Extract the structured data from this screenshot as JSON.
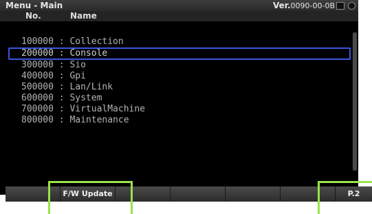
{
  "title": "Menu - Main",
  "version": {
    "label": "Ver.",
    "value": "0090-00-0B"
  },
  "columns": {
    "no": "No.",
    "name": "Name"
  },
  "menu_items": [
    {
      "text": "100000 : Collection"
    },
    {
      "text": "200000 : Console"
    },
    {
      "text": "300000 : Sio"
    },
    {
      "text": "400000 : Gpi"
    },
    {
      "text": "500000 : Lan/Link"
    },
    {
      "text": "600000 : System"
    },
    {
      "text": "700000 : VirtualMachine"
    },
    {
      "text": "800000 : Maintenance"
    }
  ],
  "selected_index": 1,
  "function_keys": [
    "",
    "F/W Update",
    "",
    "",
    "",
    "",
    "P.2"
  ],
  "colors": {
    "selection": "#3a56e0",
    "highlight": "#9be34a"
  }
}
